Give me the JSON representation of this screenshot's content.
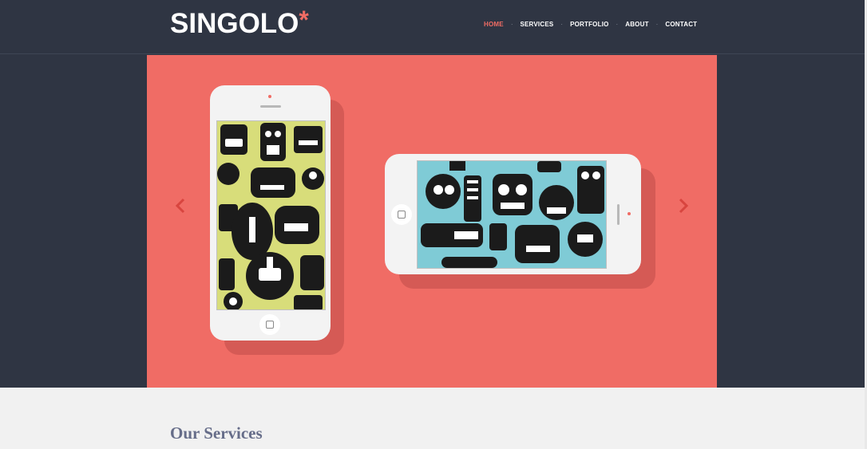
{
  "header": {
    "logo_text": "SINGOLO",
    "logo_star": "*",
    "nav": [
      {
        "label": "HOME",
        "active": true
      },
      {
        "label": "SERVICES",
        "active": false
      },
      {
        "label": "PORTFOLIO",
        "active": false
      },
      {
        "label": "ABOUT",
        "active": false
      },
      {
        "label": "CONTACT",
        "active": false
      }
    ],
    "separator": "·"
  },
  "slider": {
    "background_color": "#f06c65",
    "prev_arrow": "‹",
    "next_arrow": "›",
    "slides": [
      {
        "device": "vertical-phone",
        "screen_theme": "yellow robots pattern"
      },
      {
        "device": "horizontal-phone",
        "screen_theme": "blue robots pattern"
      }
    ]
  },
  "services": {
    "title": "Our Services"
  },
  "colors": {
    "accent": "#f06c64",
    "header_bg": "#2f3543",
    "services_title": "#666d89"
  },
  "icons": [
    "chevron-left-icon",
    "chevron-right-icon",
    "home-button-icon"
  ]
}
